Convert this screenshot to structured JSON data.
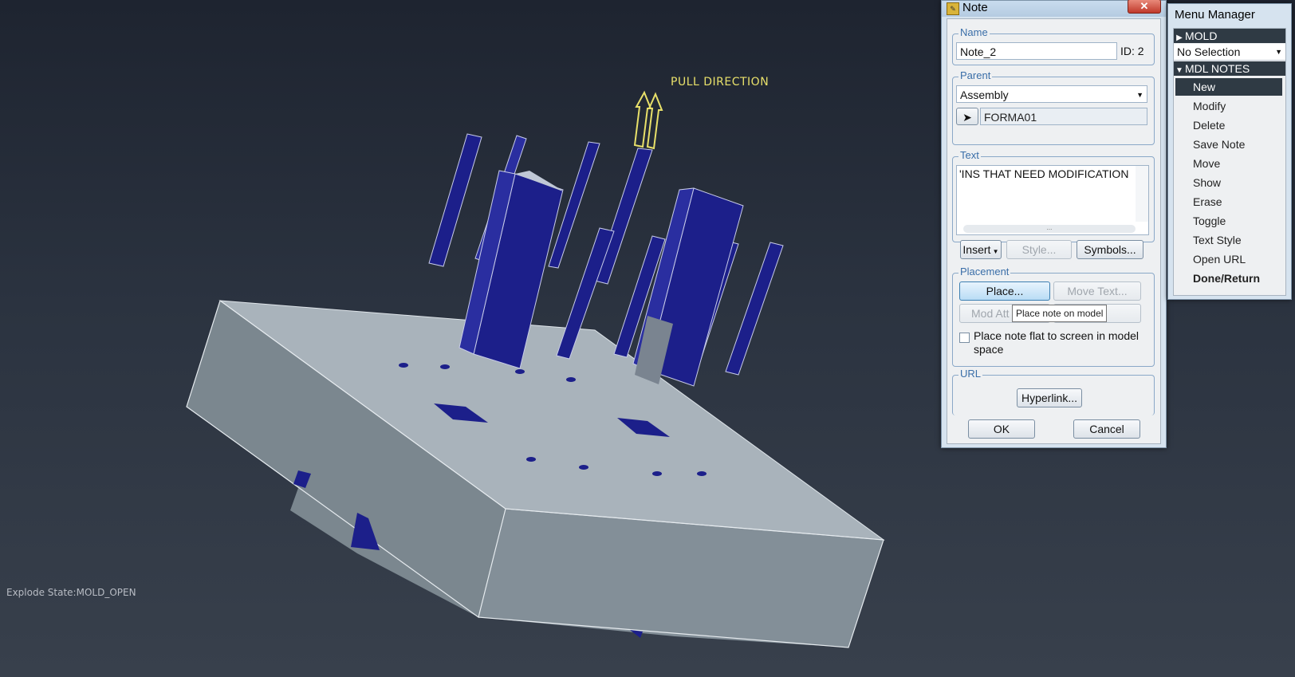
{
  "viewport": {
    "pull_direction_label": "PULL DIRECTION",
    "explode_state_label": "Explode State:MOLD_OPEN",
    "colors": {
      "background_top": "#1e2430",
      "background_bottom": "#38404c",
      "plate": "#9aa6b0",
      "pins": "#1c1f8a",
      "arrow": "#e8e06a"
    }
  },
  "note_dialog": {
    "title": "Note",
    "close_icon": "close-icon",
    "name_group": {
      "label": "Name",
      "name_value": "Note_2",
      "id_text": "ID: 2"
    },
    "parent_group": {
      "label": "Parent",
      "parent_select_value": "Assembly",
      "parent_reference": "FORMA01",
      "select_icon": "cursor-arrow-icon"
    },
    "text_group": {
      "label": "Text",
      "text_value": "'INS THAT NEED MODIFICATION",
      "scroll_thumb": "...",
      "insert_label": "Insert",
      "style_label": "Style...",
      "symbols_label": "Symbols..."
    },
    "placement_group": {
      "label": "Placement",
      "place_label": "Place...",
      "move_text_label": "Move Text...",
      "mod_attach_label": "Mod Att",
      "flat_checkbox_label": "Place note flat to screen in model space",
      "flat_checked": false
    },
    "tooltip": "Place note on model",
    "url_group": {
      "label": "URL",
      "hyperlink_label": "Hyperlink..."
    },
    "ok_label": "OK",
    "cancel_label": "Cancel"
  },
  "menu_manager": {
    "title": "Menu Manager",
    "mold_header": "MOLD",
    "selection_value": "No Selection",
    "mdl_notes_header": "MDL NOTES",
    "items": [
      {
        "label": "New",
        "selected": true
      },
      {
        "label": "Modify"
      },
      {
        "label": "Delete"
      },
      {
        "label": "Save Note"
      },
      {
        "label": "Move"
      },
      {
        "label": "Show"
      },
      {
        "label": "Erase"
      },
      {
        "label": "Toggle"
      },
      {
        "label": "Text Style"
      },
      {
        "label": "Open URL"
      },
      {
        "label": "Done/Return",
        "bold": true
      }
    ]
  }
}
